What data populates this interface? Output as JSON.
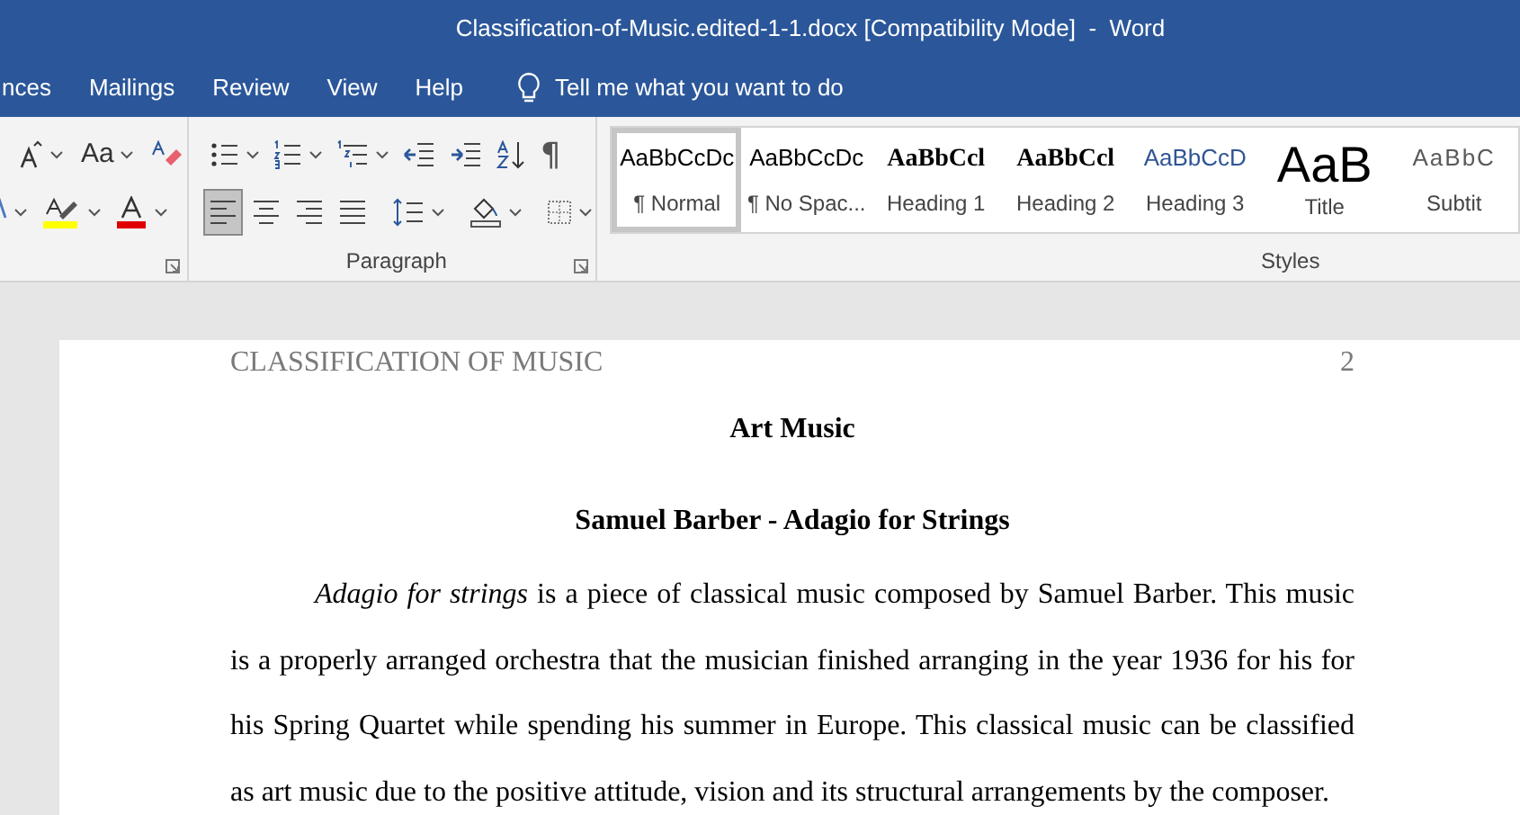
{
  "window": {
    "title": "Classification-of-Music.edited-1-1.docx [Compatibility Mode]  -  Word"
  },
  "tabs": [
    {
      "label": "nces",
      "selected": false
    },
    {
      "label": "Mailings",
      "selected": false
    },
    {
      "label": "Review",
      "selected": false
    },
    {
      "label": "View",
      "selected": false
    },
    {
      "label": "Help",
      "selected": false
    }
  ],
  "tell_me": {
    "placeholder": "Tell me what you want to do"
  },
  "font_group": {
    "row_1": [
      {
        "kind": "grow-font"
      },
      {
        "kind": "change-case",
        "label": "Aa"
      },
      {
        "kind": "clear-formatting"
      }
    ],
    "row_2": [
      {
        "kind": "text-effects"
      },
      {
        "kind": "highlight"
      },
      {
        "kind": "font-color"
      }
    ]
  },
  "paragraph_group": {
    "label": "Paragraph",
    "row_1": [
      {
        "kind": "bullets"
      },
      {
        "kind": "numbering"
      },
      {
        "kind": "multilevel"
      },
      {
        "kind": "decrease-indent"
      },
      {
        "kind": "increase-indent"
      },
      {
        "kind": "sort"
      },
      {
        "kind": "show-marks",
        "label": "¶"
      }
    ],
    "align_buttons": [
      {
        "kind": "align-left",
        "selected": true
      },
      {
        "kind": "center",
        "selected": false
      },
      {
        "kind": "align-right",
        "selected": false
      },
      {
        "kind": "justify",
        "selected": false
      }
    ],
    "row_2": [
      {
        "kind": "line-spacing"
      },
      {
        "kind": "shading"
      },
      {
        "kind": "borders"
      }
    ]
  },
  "styles_group": {
    "label": "Styles",
    "items": [
      {
        "preview": "AaBbCcDc",
        "label": "¶ Normal",
        "kind": "normal",
        "selected": true
      },
      {
        "preview": "AaBbCcDc",
        "label": "¶ No Spac...",
        "kind": "normal",
        "selected": false
      },
      {
        "preview": "AaBbCcl",
        "label": "Heading 1",
        "kind": "heading",
        "selected": false
      },
      {
        "preview": "AaBbCcl",
        "label": "Heading 2",
        "kind": "heading",
        "selected": false
      },
      {
        "preview": "AaBbCcD",
        "label": "Heading 3",
        "kind": "heading3",
        "selected": false
      },
      {
        "preview": "AaB",
        "label": "Title",
        "kind": "title",
        "selected": false
      },
      {
        "preview": "AaBbC",
        "label": "Subtit",
        "kind": "subtitle",
        "selected": false
      }
    ]
  },
  "document": {
    "header": "CLASSIFICATION OF MUSIC",
    "page_number": "2",
    "heading": "Art Music",
    "subheading": "Samuel Barber - Adagio for Strings",
    "paragraph": "*Adagio for strings* is a piece of classical music composed by Samuel Barber. This music is a properly arranged orchestra that the musician finished arranging in the year 1936 for his for his Spring Quartet while spending his summer in Europe. This classical music can be classified as art music due to the positive attitude, vision and its structural arrangements by the composer."
  }
}
